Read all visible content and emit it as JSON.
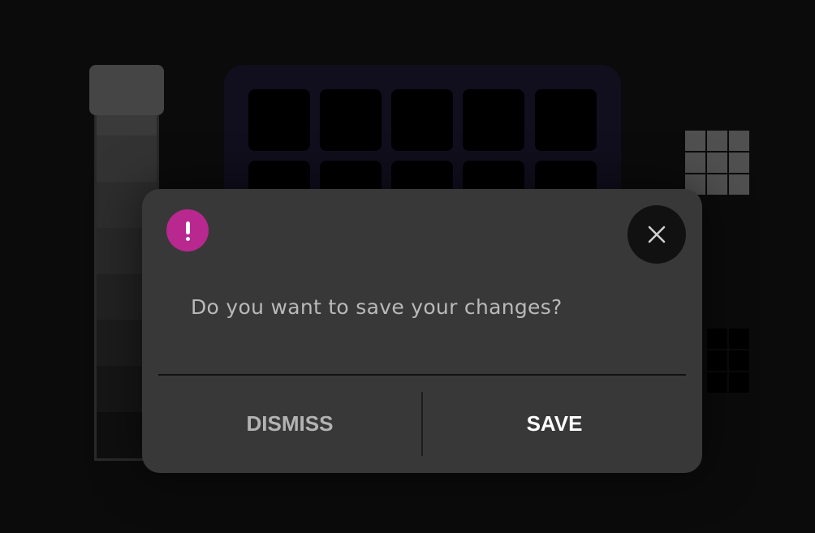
{
  "colors": {
    "background": "#0b0b0b",
    "dialog": "#383838",
    "alert_accent": "#b8288f",
    "close_button_bg": "#111111",
    "dismiss_text": "#b3b3b3",
    "save_text": "#ffffff",
    "message_text": "#b9b9b9"
  },
  "dialog": {
    "icon": "alert-exclamation-icon",
    "close_icon": "close-icon",
    "message": "Do you want to save your changes?",
    "dismiss_label": "DISMISS",
    "save_label": "SAVE"
  }
}
